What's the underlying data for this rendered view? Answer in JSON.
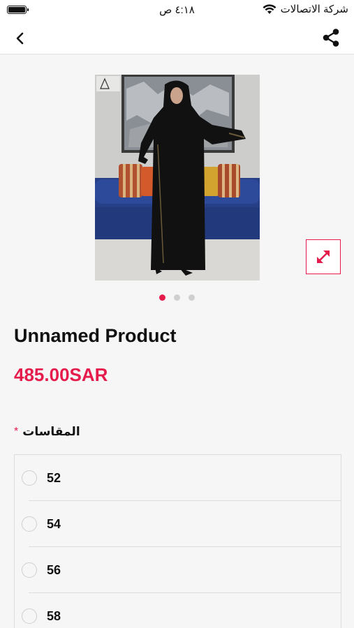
{
  "status_bar": {
    "carrier": "شركة الاتصالات",
    "time": "٤:١٨ ص",
    "battery_level": 1.0
  },
  "nav": {
    "back_icon": "chevron-left-icon",
    "share_icon": "share-icon"
  },
  "product": {
    "title": "Unnamed Product",
    "price": "485.00SAR",
    "image_count": 3,
    "active_image_index": 0
  },
  "sizes": {
    "label": "المقاسات",
    "required_marker": "*",
    "options": [
      {
        "label": "52",
        "selected": false
      },
      {
        "label": "54",
        "selected": false
      },
      {
        "label": "56",
        "selected": false
      },
      {
        "label": "58",
        "selected": false
      }
    ]
  },
  "colors": {
    "accent": "#e51b4c",
    "background": "#f6f6f6",
    "text": "#111111"
  }
}
